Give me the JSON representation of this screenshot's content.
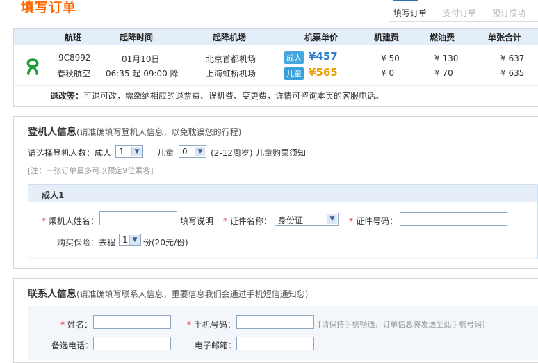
{
  "page": {
    "title": "填写订单",
    "steps": [
      "填写订单",
      "支付订单",
      "预订成功"
    ]
  },
  "flight": {
    "headers": [
      "航班",
      "起降时间",
      "起降机场",
      "机票单价",
      "机建费",
      "燃油费",
      "单张合计"
    ],
    "flight_no": "9C8992",
    "airline": "春秋航空",
    "date": "01月10日",
    "times": "06:35 起 09:00 降",
    "dep_airport": "北京首都机场",
    "arr_airport": "上海虹桥机场",
    "adult_label": "成人",
    "child_label": "儿童",
    "adult_price": "¥457",
    "child_price": "¥565",
    "adult_tax": "¥ 50",
    "child_tax": "¥ 0",
    "adult_fuel": "¥ 130",
    "child_fuel": "¥ 70",
    "adult_total": "¥ 637",
    "child_total": "¥ 635",
    "change_label": "退改签：",
    "change_text": "可退可改，需缴纳相应的退票费、误机费、变更费，详情可咨询本页的客服电话。"
  },
  "passenger": {
    "title": "登机人信息",
    "title_note": "(请准确填写登机人信息，以免耽误您的行程)",
    "count_label": "请选择登机人数：成人",
    "adult_count": "1",
    "child_label": "儿童",
    "child_count": "0",
    "age_note": "(2-12周岁)",
    "child_link": "儿童购票须知",
    "limit_note": "[注：一张订单最多可以预定9位乘客]",
    "p1_title": "成人1",
    "name_label": "乘机人姓名：",
    "name_value": "",
    "name_help": "填写说明",
    "id_type_label": "证件名称：",
    "id_type_value": "身份证",
    "id_no_label": "证件号码：",
    "id_no_value": "",
    "insurance_label": "购买保险：去程",
    "insurance_count": "1",
    "insurance_unit": "份(20元/份)"
  },
  "contact": {
    "title": "联系人信息",
    "title_note": "(请准确填写联系人信息，重要信息我们会通过手机短信通知您)",
    "name_label": "姓名：",
    "name_value": "",
    "phone_label": "手机号码：",
    "phone_value": "",
    "phone_note": "[请保持手机畅通，订单信息将发送至此手机号码]",
    "alt_phone_label": "备选电话：",
    "alt_phone_value": "",
    "email_label": "电子邮箱：",
    "email_value": ""
  },
  "required_mark": "*",
  "colors": {
    "accent": "#ff6600",
    "link": "#1a5aa6",
    "adult_price": "#2f7fcf",
    "child_price": "#f0a000"
  }
}
